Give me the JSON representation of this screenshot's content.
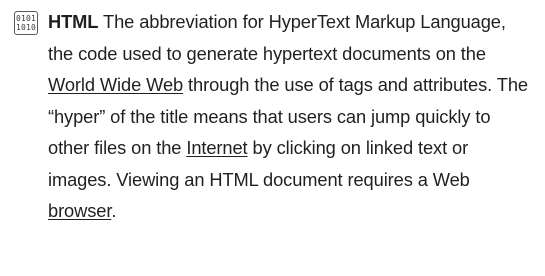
{
  "entry": {
    "icon": {
      "name": "binary-icon",
      "row1": "0101",
      "row2": "1010"
    },
    "term": "HTML",
    "text_1": " The abbreviation for HyperText Markup Language, the code used to generate hypertext documents on the ",
    "link_1": "World Wide Web",
    "text_2": " through the use of tags and attributes. The “hyper” of the title means that users can jump quickly to other files on the ",
    "link_2": "Internet",
    "text_3": " by clicking on linked text or images. Viewing an HTML document requires a Web ",
    "link_3": "browser",
    "text_4": "."
  }
}
